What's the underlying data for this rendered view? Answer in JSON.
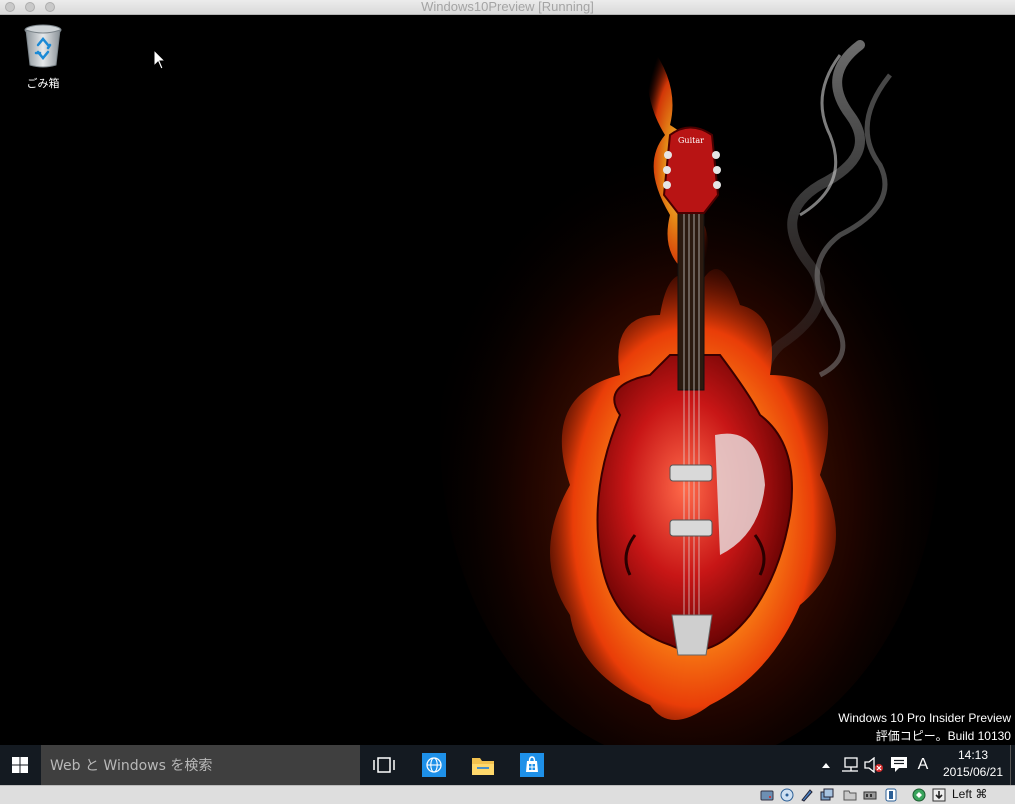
{
  "window": {
    "title": "Windows10Preview [Running]"
  },
  "desktop": {
    "recycle_bin_label": "ごみ箱",
    "watermark_line1": "Windows 10 Pro Insider Preview",
    "watermark_line2": "評価コピー。Build 10130",
    "wallpaper_headstock_text": "Guitar"
  },
  "taskbar": {
    "search_placeholder": "Web と Windows を検索",
    "pinned": [
      "task-view",
      "internet-explorer",
      "file-explorer",
      "store"
    ],
    "ime_mode": "A",
    "time": "14:13",
    "date": "2015/06/21"
  },
  "host_status": {
    "host_key": "Left ⌘"
  },
  "colors": {
    "taskbar": "#141a21",
    "search_box": "#3f3f3f",
    "accent": "#1e90e8"
  }
}
